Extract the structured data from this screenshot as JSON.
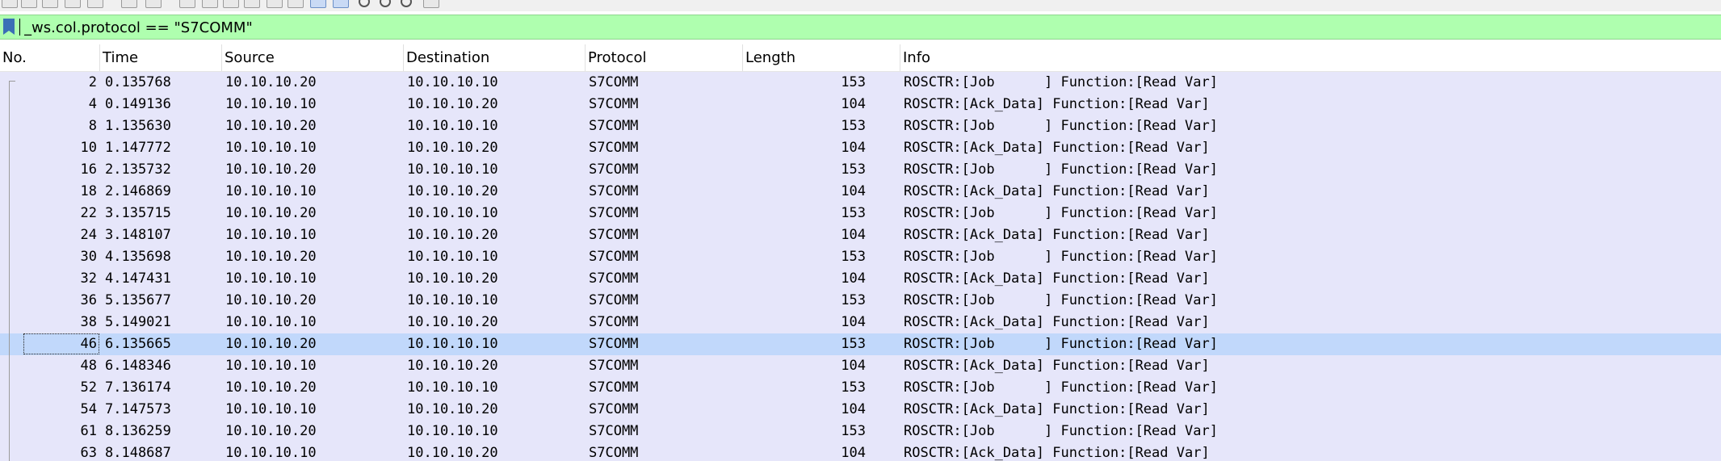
{
  "toolbar": {
    "icons": [
      "stop-capture",
      "restart-capture",
      "capture-options",
      "open-file",
      "save-file",
      "close-file",
      "reload-file",
      "find-packet",
      "go-back",
      "go-forward",
      "go-to-packet",
      "go-first",
      "go-last",
      "auto-scroll",
      "colorize",
      "zoom-in",
      "zoom-out",
      "zoom-normal",
      "resize-columns"
    ]
  },
  "filter": {
    "value": "_ws.col.protocol == \"S7COMM\""
  },
  "columns": [
    "No.",
    "Time",
    "Source",
    "Destination",
    "Protocol",
    "Length",
    "Info"
  ],
  "packets": [
    {
      "no": "2",
      "time": "0.135768",
      "source": "10.10.10.20",
      "destination": "10.10.10.10",
      "protocol": "S7COMM",
      "length": "153",
      "info": "ROSCTR:[Job      ] Function:[Read Var]"
    },
    {
      "no": "4",
      "time": "0.149136",
      "source": "10.10.10.10",
      "destination": "10.10.10.20",
      "protocol": "S7COMM",
      "length": "104",
      "info": "ROSCTR:[Ack_Data] Function:[Read Var]"
    },
    {
      "no": "8",
      "time": "1.135630",
      "source": "10.10.10.20",
      "destination": "10.10.10.10",
      "protocol": "S7COMM",
      "length": "153",
      "info": "ROSCTR:[Job      ] Function:[Read Var]"
    },
    {
      "no": "10",
      "time": "1.147772",
      "source": "10.10.10.10",
      "destination": "10.10.10.20",
      "protocol": "S7COMM",
      "length": "104",
      "info": "ROSCTR:[Ack_Data] Function:[Read Var]"
    },
    {
      "no": "16",
      "time": "2.135732",
      "source": "10.10.10.20",
      "destination": "10.10.10.10",
      "protocol": "S7COMM",
      "length": "153",
      "info": "ROSCTR:[Job      ] Function:[Read Var]"
    },
    {
      "no": "18",
      "time": "2.146869",
      "source": "10.10.10.10",
      "destination": "10.10.10.20",
      "protocol": "S7COMM",
      "length": "104",
      "info": "ROSCTR:[Ack_Data] Function:[Read Var]"
    },
    {
      "no": "22",
      "time": "3.135715",
      "source": "10.10.10.20",
      "destination": "10.10.10.10",
      "protocol": "S7COMM",
      "length": "153",
      "info": "ROSCTR:[Job      ] Function:[Read Var]"
    },
    {
      "no": "24",
      "time": "3.148107",
      "source": "10.10.10.10",
      "destination": "10.10.10.20",
      "protocol": "S7COMM",
      "length": "104",
      "info": "ROSCTR:[Ack_Data] Function:[Read Var]"
    },
    {
      "no": "30",
      "time": "4.135698",
      "source": "10.10.10.20",
      "destination": "10.10.10.10",
      "protocol": "S7COMM",
      "length": "153",
      "info": "ROSCTR:[Job      ] Function:[Read Var]"
    },
    {
      "no": "32",
      "time": "4.147431",
      "source": "10.10.10.10",
      "destination": "10.10.10.20",
      "protocol": "S7COMM",
      "length": "104",
      "info": "ROSCTR:[Ack_Data] Function:[Read Var]"
    },
    {
      "no": "36",
      "time": "5.135677",
      "source": "10.10.10.20",
      "destination": "10.10.10.10",
      "protocol": "S7COMM",
      "length": "153",
      "info": "ROSCTR:[Job      ] Function:[Read Var]"
    },
    {
      "no": "38",
      "time": "5.149021",
      "source": "10.10.10.10",
      "destination": "10.10.10.20",
      "protocol": "S7COMM",
      "length": "104",
      "info": "ROSCTR:[Ack_Data] Function:[Read Var]"
    },
    {
      "no": "46",
      "time": "6.135665",
      "source": "10.10.10.20",
      "destination": "10.10.10.10",
      "protocol": "S7COMM",
      "length": "153",
      "info": "ROSCTR:[Job      ] Function:[Read Var]",
      "selected": true,
      "focused": true
    },
    {
      "no": "48",
      "time": "6.148346",
      "source": "10.10.10.10",
      "destination": "10.10.10.20",
      "protocol": "S7COMM",
      "length": "104",
      "info": "ROSCTR:[Ack_Data] Function:[Read Var]"
    },
    {
      "no": "52",
      "time": "7.136174",
      "source": "10.10.10.20",
      "destination": "10.10.10.10",
      "protocol": "S7COMM",
      "length": "153",
      "info": "ROSCTR:[Job      ] Function:[Read Var]"
    },
    {
      "no": "54",
      "time": "7.147573",
      "source": "10.10.10.10",
      "destination": "10.10.10.20",
      "protocol": "S7COMM",
      "length": "104",
      "info": "ROSCTR:[Ack_Data] Function:[Read Var]"
    },
    {
      "no": "61",
      "time": "8.136259",
      "source": "10.10.10.20",
      "destination": "10.10.10.10",
      "protocol": "S7COMM",
      "length": "153",
      "info": "ROSCTR:[Job      ] Function:[Read Var]"
    },
    {
      "no": "63",
      "time": "8.148687",
      "source": "10.10.10.10",
      "destination": "10.10.10.20",
      "protocol": "S7COMM",
      "length": "104",
      "info": "ROSCTR:[Ack_Data] Function:[Read Var]"
    }
  ],
  "colors": {
    "filter_bg": "#afffaf",
    "row_bg": "#e6e6fa",
    "selected_bg": "#c1d8fb"
  }
}
